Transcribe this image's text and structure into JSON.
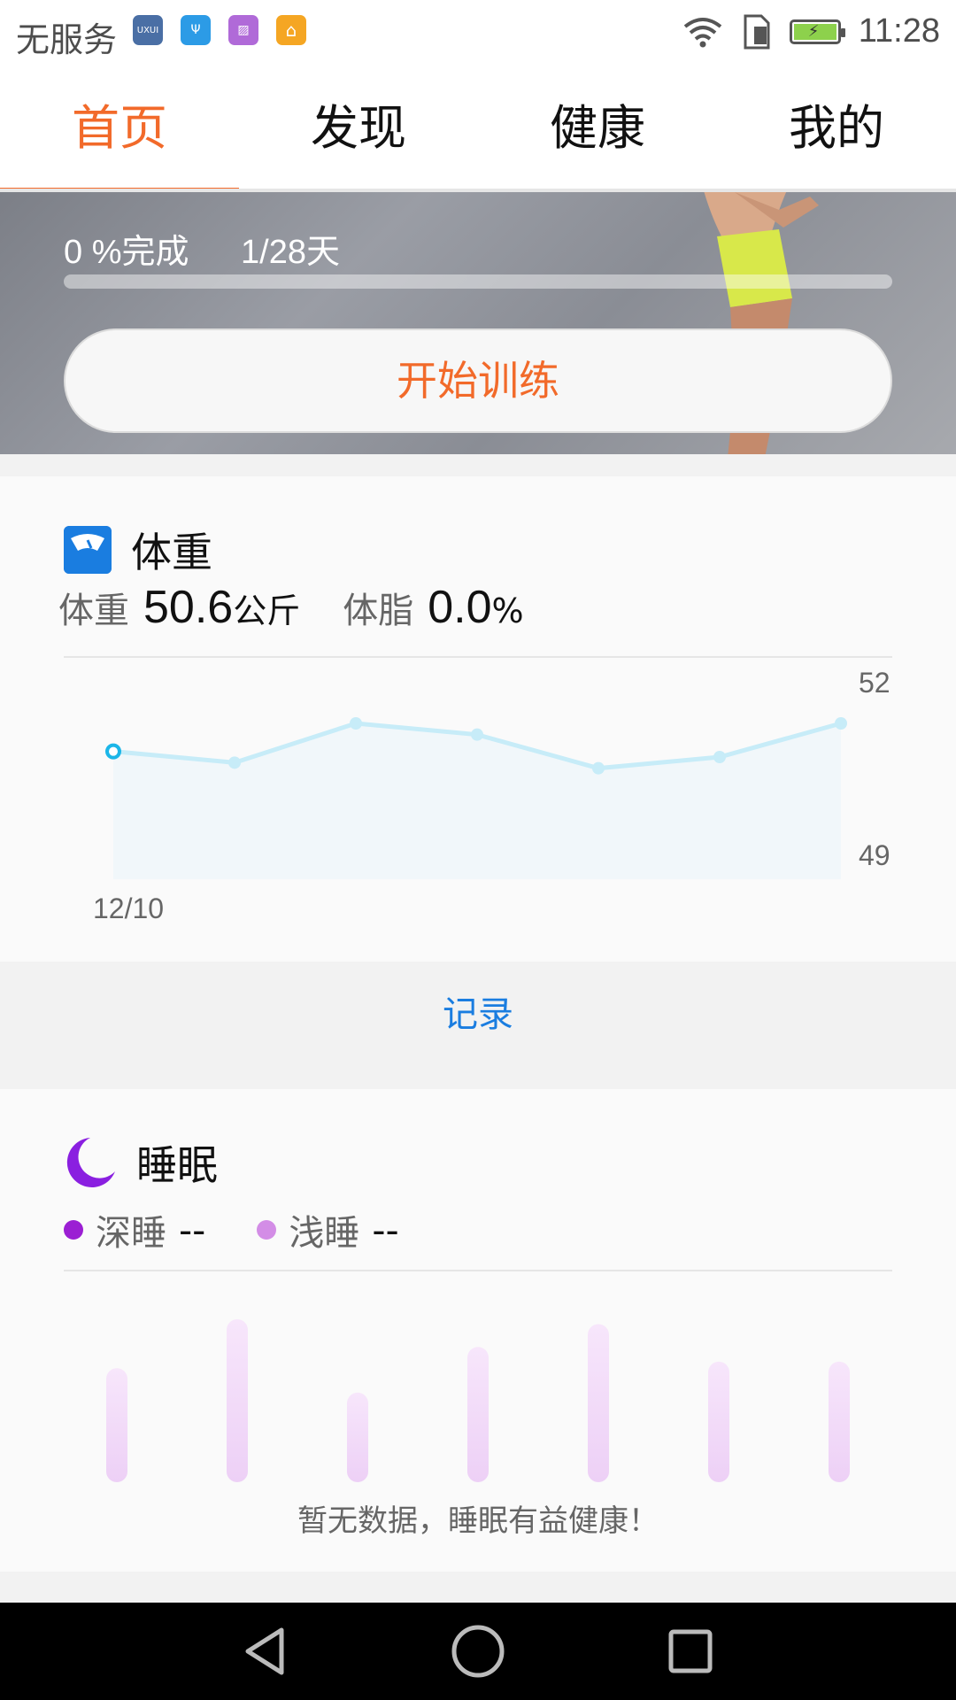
{
  "status_bar": {
    "carrier": "无服务",
    "time": "11:28",
    "app_icons": [
      {
        "icon": "uniui-app-icon",
        "color": "#4a6fa5",
        "label": "UXUI"
      },
      {
        "icon": "usb-icon",
        "color": "#2c9be6",
        "label": "Ψ"
      },
      {
        "icon": "gallery-icon",
        "color": "#b06ad8",
        "label": "▨"
      },
      {
        "icon": "home-app-icon",
        "color": "#f5a623",
        "label": "⌂"
      }
    ]
  },
  "tabs": {
    "items": [
      {
        "label": "首页",
        "active": true
      },
      {
        "label": "发现",
        "active": false
      },
      {
        "label": "健康",
        "active": false
      },
      {
        "label": "我的",
        "active": false
      }
    ]
  },
  "hero": {
    "completion_text": "0 %完成",
    "day_text": "1/28天",
    "progress": 0,
    "start_button": "开始训练"
  },
  "weight": {
    "title": "体重",
    "weight_label": "体重",
    "weight_value": "50.6",
    "weight_unit": "公斤",
    "fat_label": "体脂",
    "fat_value": "0.0",
    "fat_unit": "%",
    "y_max_label": "52",
    "y_min_label": "49",
    "x_label": "12/10",
    "record_button": "记录"
  },
  "chart_data": {
    "type": "area",
    "xlabel": "",
    "ylabel": "",
    "ylim": [
      49,
      52
    ],
    "x": [
      "12/10",
      "",
      "",
      "",
      "",
      "",
      ""
    ],
    "series": [
      {
        "values": [
          50.6,
          50.4,
          51.1,
          50.9,
          50.3,
          50.5,
          51.1
        ]
      }
    ]
  },
  "sleep": {
    "title": "睡眠",
    "deep_label": "深睡",
    "deep_value": "--",
    "light_label": "浅睡",
    "light_value": "--",
    "deep_color": "#9b1fd3",
    "light_color": "#d38de6",
    "bar_levels": [
      0.7,
      1.0,
      0.55,
      0.83,
      0.97,
      0.74,
      0.74
    ],
    "empty_note": "暂无数据，睡眠有益健康！"
  },
  "colors": {
    "accent": "#f26a2a",
    "link": "#1a7de0",
    "chart_line": "#c7ecf8"
  }
}
